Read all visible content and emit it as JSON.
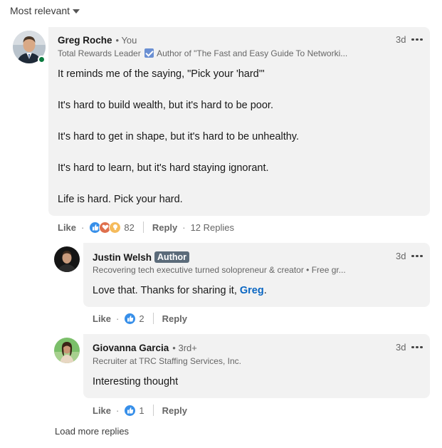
{
  "sort": {
    "label": "Most relevant"
  },
  "comment": {
    "author": "Greg Roche",
    "relation": "• You",
    "headline_role": "Total Rewards Leader",
    "headline_rest": "Author of \"The Fast and Easy Guide To Networki...",
    "time": "3d",
    "lines": [
      "It reminds me of the saying, \"Pick your 'hard'\"",
      "It's hard to build wealth, but it's hard to be poor.",
      "It's hard to get in shape, but it's hard to be unhealthy.",
      "It's hard to learn, but it's hard staying ignorant.",
      "Life is hard. Pick your hard."
    ],
    "like_label": "Like",
    "reaction_count": "82",
    "reply_label": "Reply",
    "replies_label": "12 Replies",
    "separator": "·"
  },
  "replies": [
    {
      "author": "Justin Welsh",
      "badge": "Author",
      "headline": "Recovering tech executive turned solopreneur & creator • Free gr...",
      "time": "3d",
      "text_before": "Love that. Thanks for sharing it, ",
      "mention": "Greg",
      "text_after": ".",
      "like_label": "Like",
      "reaction_count": "2",
      "reply_label": "Reply",
      "separator": "·"
    },
    {
      "author": "Giovanna Garcia",
      "degree": "• 3rd+",
      "headline": "Recruiter at TRC Staffing Services, Inc.",
      "time": "3d",
      "text": "Interesting thought",
      "like_label": "Like",
      "reaction_count": "1",
      "reply_label": "Reply",
      "separator": "·"
    }
  ],
  "load_more": "Load more replies",
  "colors": {
    "bubble": "#f2f2f2",
    "mention": "#0a66c2",
    "presence": "#0a7a3e",
    "author_badge": "#5b6b7a",
    "like_reaction": "#378fe9",
    "love_reaction": "#df704d",
    "insight_reaction": "#f5bb5c"
  }
}
